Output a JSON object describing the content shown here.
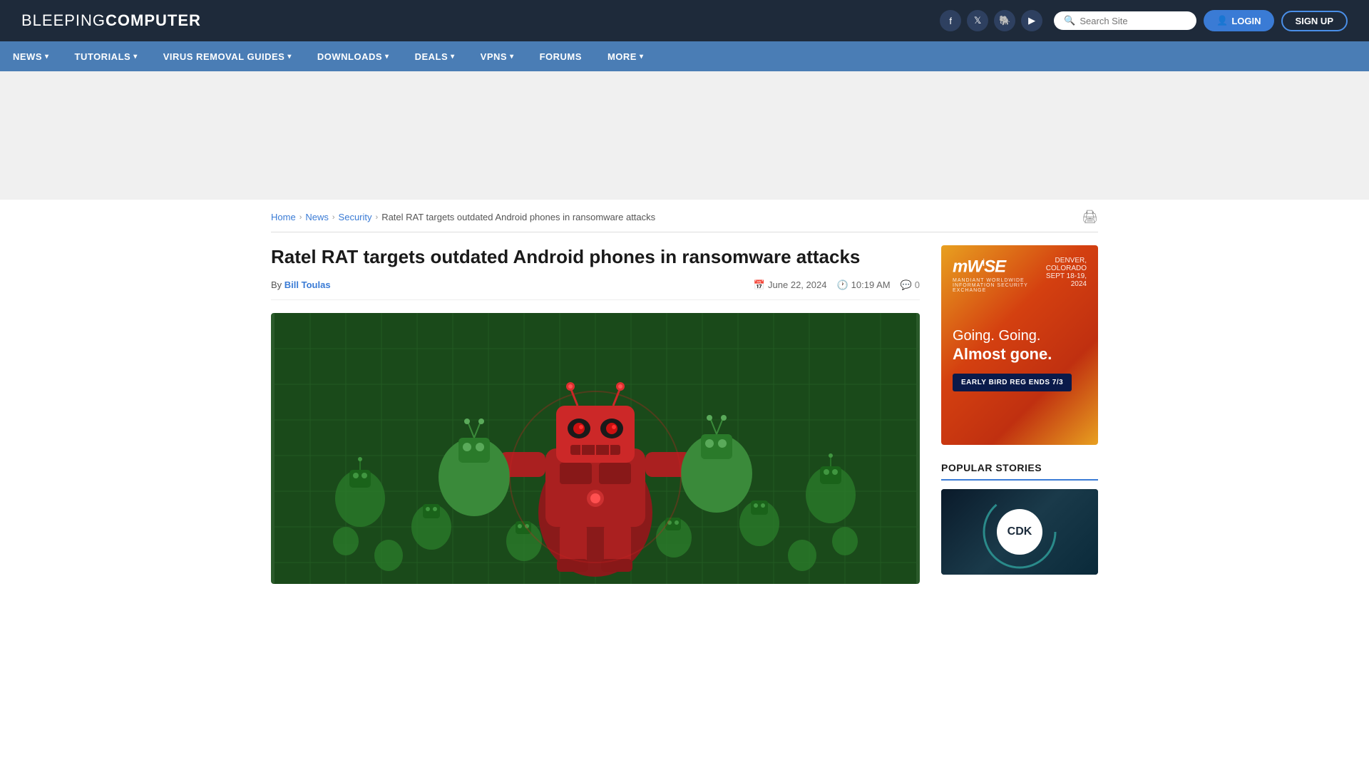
{
  "header": {
    "logo_light": "BLEEPING",
    "logo_bold": "COMPUTER",
    "social_icons": [
      {
        "name": "facebook-icon",
        "symbol": "f"
      },
      {
        "name": "twitter-icon",
        "symbol": "t"
      },
      {
        "name": "mastodon-icon",
        "symbol": "m"
      },
      {
        "name": "youtube-icon",
        "symbol": "▶"
      }
    ],
    "search_placeholder": "Search Site",
    "login_label": "LOGIN",
    "signup_label": "SIGN UP"
  },
  "nav": {
    "items": [
      {
        "label": "NEWS",
        "has_dropdown": true
      },
      {
        "label": "TUTORIALS",
        "has_dropdown": true
      },
      {
        "label": "VIRUS REMOVAL GUIDES",
        "has_dropdown": true
      },
      {
        "label": "DOWNLOADS",
        "has_dropdown": true
      },
      {
        "label": "DEALS",
        "has_dropdown": true
      },
      {
        "label": "VPNS",
        "has_dropdown": true
      },
      {
        "label": "FORUMS",
        "has_dropdown": false
      },
      {
        "label": "MORE",
        "has_dropdown": true
      }
    ]
  },
  "breadcrumb": {
    "home": "Home",
    "news": "News",
    "security": "Security",
    "current": "Ratel RAT targets outdated Android phones in ransomware attacks"
  },
  "article": {
    "title": "Ratel RAT targets outdated Android phones in ransomware attacks",
    "author_label": "By",
    "author_name": "Bill Toulas",
    "date": "June 22, 2024",
    "time": "10:19 AM",
    "comments_count": "0"
  },
  "sidebar_ad": {
    "logo": "mW⁰SE",
    "logo_text": "mWiSE",
    "sub": "MANDIANT WORLDWIDE INFORMATION SECURITY EXCHANGE",
    "location": "DENVER, COLORADO",
    "date_range": "SEPT 18-19, 2024",
    "line1": "Going. Going.",
    "line2": "Almost gone.",
    "cta": "EARLY BIRD REG ENDS 7/3"
  },
  "popular_stories": {
    "title": "POPULAR STORIES",
    "cdk_logo": "CDK"
  }
}
